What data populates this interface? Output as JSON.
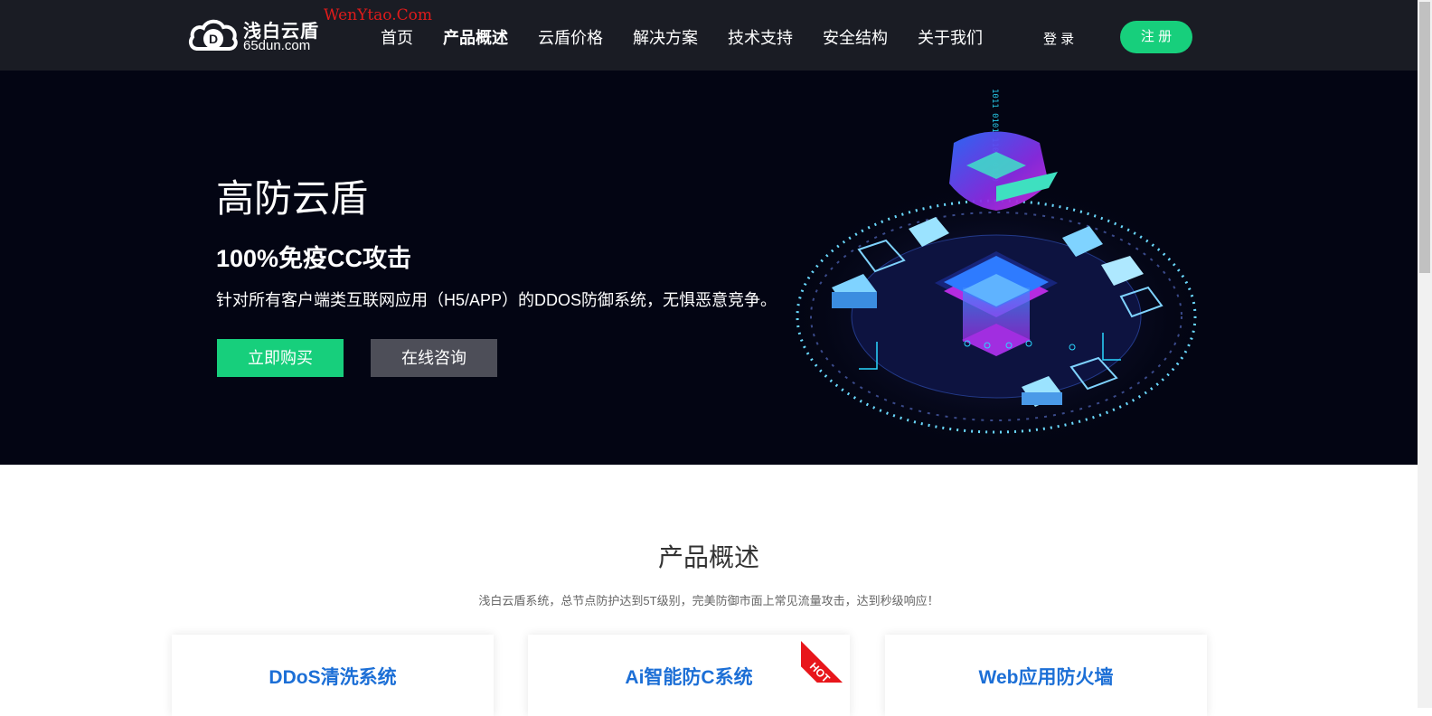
{
  "brand": {
    "name": "浅白云盾",
    "domain": "65dun.com",
    "logo_letter": "D",
    "watermark": "WenYtao.Com"
  },
  "nav": {
    "items": [
      {
        "label": "首页",
        "active": false
      },
      {
        "label": "产品概述",
        "active": true
      },
      {
        "label": "云盾价格",
        "active": false
      },
      {
        "label": "解决方案",
        "active": false
      },
      {
        "label": "技术支持",
        "active": false
      },
      {
        "label": "安全结构",
        "active": false
      },
      {
        "label": "关于我们",
        "active": false
      }
    ],
    "login_label": "登 录",
    "register_label": "注 册"
  },
  "hero": {
    "title": "高防云盾",
    "subtitle": "100%免疫CC攻击",
    "description": "针对所有客户端类互联网应用（H5/APP）的DDOS防御系统，无惧恶意竞争。",
    "buy_label": "立即购买",
    "consult_label": "在线咨询",
    "art_binary": "1011 0101 1100 0110"
  },
  "products": {
    "title": "产品概述",
    "description": "浅白云盾系统，总节点防护达到5T级别，完美防御市面上常见流量攻击，达到秒级响应！",
    "cards": [
      {
        "title": "DDoS清洗系统",
        "hot": false
      },
      {
        "title": "Ai智能防C系统",
        "hot": true
      },
      {
        "title": "Web应用防火墙",
        "hot": false
      }
    ],
    "hot_label": "HOT"
  },
  "colors": {
    "nav_bg": "#1a1c24",
    "hero_bg": "#030513",
    "accent_green": "#17cf7c",
    "consult_gray": "#4d4e58",
    "card_title_blue": "#1c6fd6",
    "hot_red": "#e8161b"
  }
}
